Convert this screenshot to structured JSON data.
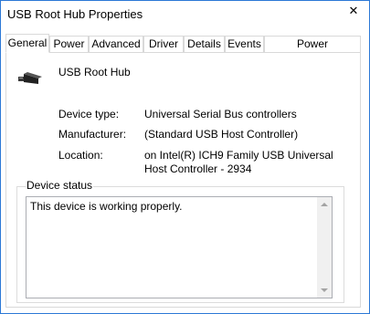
{
  "window": {
    "title": "USB Root Hub Properties",
    "close_glyph": "✕"
  },
  "tabs": [
    {
      "label": "General"
    },
    {
      "label": "Power"
    },
    {
      "label": "Advanced"
    },
    {
      "label": "Driver"
    },
    {
      "label": "Details"
    },
    {
      "label": "Events"
    },
    {
      "label": "Power Management"
    }
  ],
  "device": {
    "name": "USB Root Hub",
    "icon": "usb-connector-icon",
    "type_label": "Device type:",
    "type_value": "Universal Serial Bus controllers",
    "manufacturer_label": "Manufacturer:",
    "manufacturer_value": "(Standard USB Host Controller)",
    "location_label": "Location:",
    "location_value": "on Intel(R) ICH9 Family USB Universal Host Controller - 2934"
  },
  "status": {
    "group_label": "Device status",
    "text": "This device is working properly."
  },
  "colors": {
    "window_border": "#2b78d6",
    "tab_border": "#d9d9d9"
  }
}
